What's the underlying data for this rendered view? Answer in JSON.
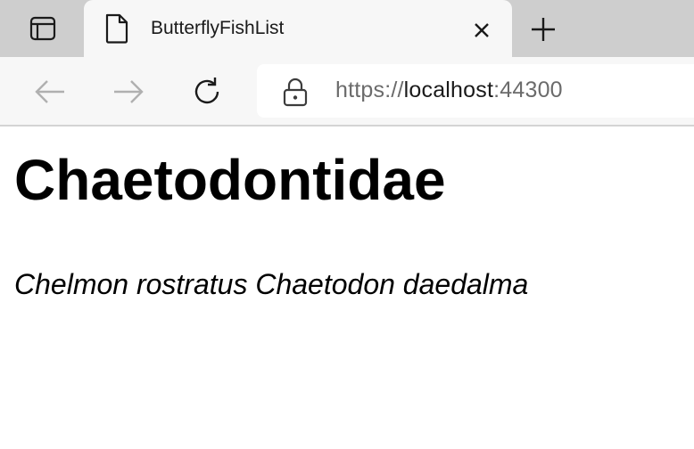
{
  "browser": {
    "tab": {
      "title": "ButterflyFishList",
      "favicon": "page-icon"
    },
    "address_bar": {
      "scheme": "https://",
      "host": "localhost",
      "port": ":44300"
    },
    "icons": {
      "tab_actions": "tab-actions-icon",
      "close": "close-icon",
      "new_tab": "plus-icon",
      "back": "back-arrow-icon",
      "forward": "forward-arrow-icon",
      "refresh": "refresh-icon",
      "lock": "lock-icon"
    }
  },
  "page": {
    "heading": "Chaetodontidae",
    "species": "Chelmon rostratus Chaetodon daedalma"
  }
}
